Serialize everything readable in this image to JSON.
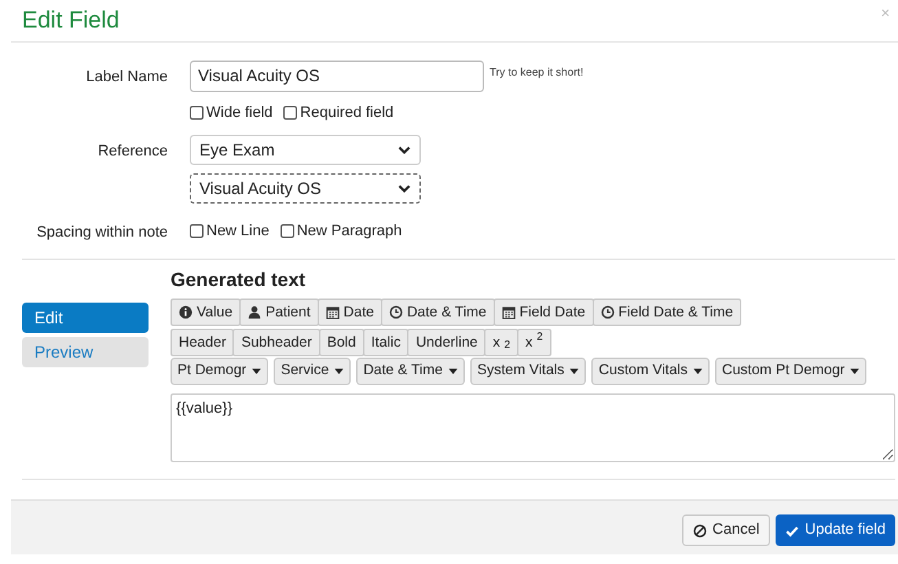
{
  "dialog": {
    "title": "Edit Field",
    "close": "×"
  },
  "form": {
    "label_name": {
      "label": "Label Name",
      "value": "Visual Acuity OS",
      "hint": "Try to keep it short!"
    },
    "options": [
      {
        "label": "Wide field",
        "checked": false
      },
      {
        "label": "Required field",
        "checked": false
      }
    ],
    "reference": {
      "label": "Reference",
      "selects": [
        "Eye Exam",
        "Visual Acuity OS"
      ]
    },
    "spacing": {
      "label": "Spacing within note",
      "options": [
        {
          "label": "New Line",
          "checked": false
        },
        {
          "label": "New Paragraph",
          "checked": false
        }
      ]
    }
  },
  "tabs": [
    {
      "label": "Edit",
      "selected": true
    },
    {
      "label": "Preview",
      "selected": false
    }
  ],
  "generated": {
    "title": "Generated text",
    "insert_buttons": [
      {
        "label": "Value",
        "kind": "info"
      },
      {
        "label": "Patient",
        "kind": "user"
      },
      {
        "label": "Date",
        "kind": "calendar"
      },
      {
        "label": "Date & Time",
        "kind": "clock"
      },
      {
        "label": "Field Date",
        "kind": "calendar"
      },
      {
        "label": "Field Date & Time",
        "kind": "clock"
      }
    ],
    "format_buttons": [
      "Header",
      "Subheader",
      "Bold",
      "Italic",
      "Underline",
      "x$_{2}$",
      "x$^{2}$"
    ],
    "dropdowns": [
      "Pt Demogr",
      "Service",
      "Date & Time",
      "System Vitals",
      "Custom Vitals",
      "Custom Pt Demogr"
    ],
    "text": "{{value}}"
  },
  "footer": {
    "cancel": "Cancel",
    "submit": "Update field"
  }
}
